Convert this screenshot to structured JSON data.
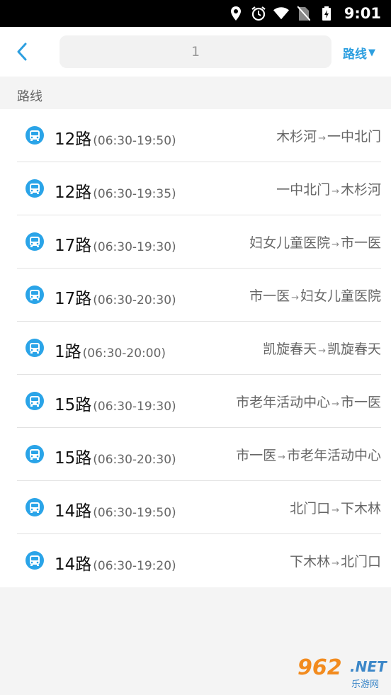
{
  "status_bar": {
    "time": "9:01",
    "icons": [
      "location-icon",
      "alarm-icon",
      "wifi-icon",
      "no-sim-icon",
      "battery-charging-icon"
    ]
  },
  "header": {
    "back_icon": "chevron-left-icon",
    "search_value": "1",
    "type_label": "路线",
    "type_caret": "▼"
  },
  "section": {
    "title": "路线"
  },
  "routes": [
    {
      "name": "12路",
      "hours": "(06:30-19:50)",
      "from": "木杉河",
      "to": "一中北门"
    },
    {
      "name": "12路",
      "hours": "(06:30-19:35)",
      "from": "一中北门",
      "to": "木杉河"
    },
    {
      "name": "17路",
      "hours": "(06:30-19:30)",
      "from": "妇女儿童医院",
      "to": "市一医"
    },
    {
      "name": "17路",
      "hours": "(06:30-20:30)",
      "from": "市一医",
      "to": "妇女儿童医院"
    },
    {
      "name": "1路",
      "hours": "(06:30-20:00)",
      "from": "凯旋春天",
      "to": "凯旋春天"
    },
    {
      "name": "15路",
      "hours": "(06:30-19:30)",
      "from": "市老年活动中心",
      "to": "市一医"
    },
    {
      "name": "15路",
      "hours": "(06:30-20:30)",
      "from": "市一医",
      "to": "市老年活动中心"
    },
    {
      "name": "14路",
      "hours": "(06:30-19:50)",
      "from": "北门口",
      "to": "下木林"
    },
    {
      "name": "14路",
      "hours": "(06:30-19:20)",
      "from": "下木林",
      "to": "北门口"
    }
  ],
  "arrow": "→",
  "colors": {
    "accent": "#2d9fe0",
    "bus_icon": "#2aa4e8"
  },
  "watermark": {
    "number": "962",
    "suffix": ".NET",
    "subtitle": "乐游网"
  }
}
